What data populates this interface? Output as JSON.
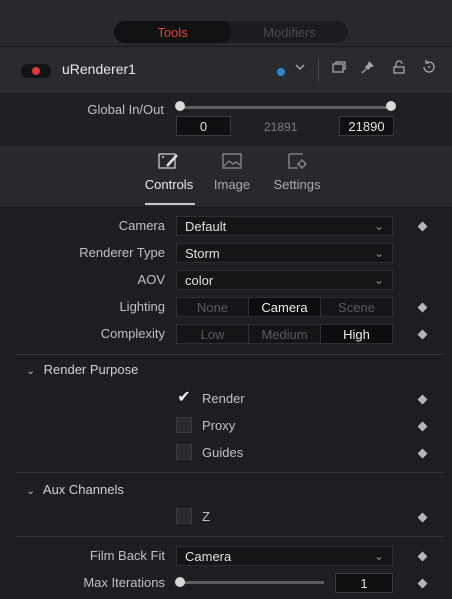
{
  "header": {
    "tabs": [
      {
        "label": "Tools",
        "active": true
      },
      {
        "label": "Modifiers",
        "active": false
      }
    ]
  },
  "node": {
    "name": "uRenderer1",
    "color_dot": "#2f86c8",
    "icons": [
      "power-toggle-icon",
      "color-dot-icon",
      "chevron-down-icon",
      "versions-icon",
      "pin-icon",
      "lock-icon",
      "reset-icon"
    ]
  },
  "global": {
    "label": "Global In/Out",
    "in_value": "0",
    "mid_value": "21891",
    "out_value": "21890"
  },
  "view_tabs": [
    {
      "label": "Controls",
      "icon": "controls-icon",
      "active": true
    },
    {
      "label": "Image",
      "icon": "image-icon",
      "active": false
    },
    {
      "label": "Settings",
      "icon": "settings-icon",
      "active": false
    }
  ],
  "controls": {
    "camera": {
      "label": "Camera",
      "value": "Default"
    },
    "renderer_type": {
      "label": "Renderer Type",
      "value": "Storm"
    },
    "aov": {
      "label": "AOV",
      "value": "color"
    },
    "lighting": {
      "label": "Lighting",
      "options": [
        "None",
        "Camera",
        "Scene"
      ],
      "selected": "Camera"
    },
    "complexity": {
      "label": "Complexity",
      "options": [
        "Low",
        "Medium",
        "High"
      ],
      "selected": "High"
    }
  },
  "render_purpose": {
    "title": "Render Purpose",
    "items": [
      {
        "label": "Render",
        "checked": true
      },
      {
        "label": "Proxy",
        "checked": false
      },
      {
        "label": "Guides",
        "checked": false
      }
    ]
  },
  "aux_channels": {
    "title": "Aux Channels",
    "items": [
      {
        "label": "Z",
        "checked": false
      }
    ]
  },
  "film_back_fit": {
    "label": "Film Back Fit",
    "value": "Camera"
  },
  "max_iterations": {
    "label": "Max Iterations",
    "value": "1"
  }
}
